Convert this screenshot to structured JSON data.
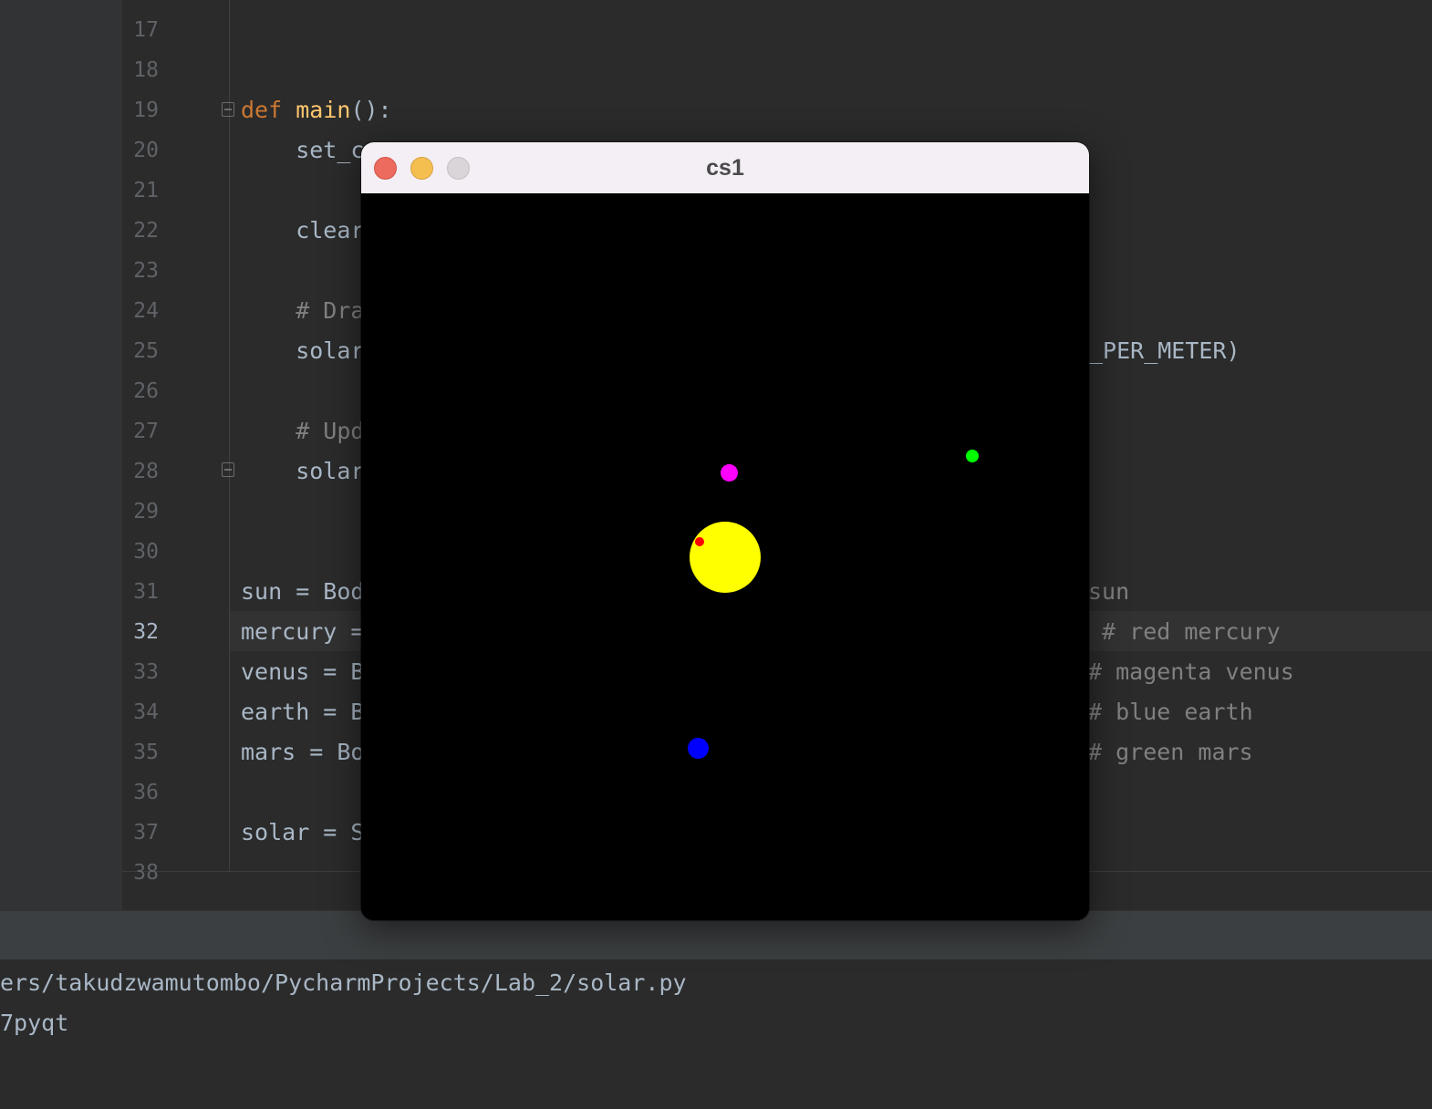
{
  "editor": {
    "lines": [
      {
        "num": "17",
        "tokens": []
      },
      {
        "num": "18",
        "tokens": []
      },
      {
        "num": "19",
        "tokens": [
          {
            "t": "def",
            "c": "kw"
          },
          {
            "t": " ",
            "c": ""
          },
          {
            "t": "main",
            "c": "fn"
          },
          {
            "t": "():",
            "c": ""
          }
        ]
      },
      {
        "num": "20",
        "tokens": [
          {
            "t": "    set_c",
            "c": ""
          }
        ]
      },
      {
        "num": "21",
        "tokens": []
      },
      {
        "num": "22",
        "tokens": [
          {
            "t": "    clear",
            "c": ""
          }
        ]
      },
      {
        "num": "23",
        "tokens": []
      },
      {
        "num": "24",
        "tokens": [
          {
            "t": "    # Dra",
            "c": "comment"
          }
        ]
      },
      {
        "num": "25",
        "tokens": [
          {
            "t": "    solar",
            "c": ""
          }
        ]
      },
      {
        "num": "26",
        "tokens": []
      },
      {
        "num": "27",
        "tokens": [
          {
            "t": "    # Upd",
            "c": "comment"
          }
        ]
      },
      {
        "num": "28",
        "tokens": [
          {
            "t": "    solar",
            "c": ""
          }
        ]
      },
      {
        "num": "29",
        "tokens": []
      },
      {
        "num": "30",
        "tokens": []
      },
      {
        "num": "31",
        "tokens": [
          {
            "t": "sun = Bod",
            "c": ""
          }
        ]
      },
      {
        "num": "32",
        "tokens": [
          {
            "t": "mercury =",
            "c": ""
          }
        ]
      },
      {
        "num": "33",
        "tokens": [
          {
            "t": "venus = B",
            "c": ""
          }
        ]
      },
      {
        "num": "34",
        "tokens": [
          {
            "t": "earth = B",
            "c": ""
          }
        ]
      },
      {
        "num": "35",
        "tokens": [
          {
            "t": "mars = Bo",
            "c": ""
          }
        ]
      },
      {
        "num": "36",
        "tokens": []
      },
      {
        "num": "37",
        "tokens": [
          {
            "t": "solar = S",
            "c": ""
          }
        ]
      },
      {
        "num": "38",
        "tokens": []
      }
    ],
    "active_line": "32",
    "right_fragments": [
      {
        "line": "25",
        "text": "_PER_METER)",
        "c": ""
      },
      {
        "line": "31",
        "text": "sun",
        "c": "comment"
      },
      {
        "line": "32",
        "text": " # red mercury",
        "c": "comment"
      },
      {
        "line": "33",
        "text": "# magenta venus",
        "c": "comment"
      },
      {
        "line": "34",
        "text": "# blue earth",
        "c": "comment"
      },
      {
        "line": "35",
        "text": "# green mars",
        "c": "comment"
      }
    ]
  },
  "terminal": {
    "lines": [
      "ers/takudzwamutombo/PycharmProjects/Lab_2/solar.py",
      "7pyqt"
    ]
  },
  "window": {
    "title": "cs1",
    "background": "#000000",
    "bodies": [
      {
        "name": "sun",
        "color": "#ffff00"
      },
      {
        "name": "mercury",
        "color": "#ff0000"
      },
      {
        "name": "venus",
        "color": "#ff00ff"
      },
      {
        "name": "earth",
        "color": "#0000ff"
      },
      {
        "name": "mars",
        "color": "#00ff00"
      }
    ]
  }
}
